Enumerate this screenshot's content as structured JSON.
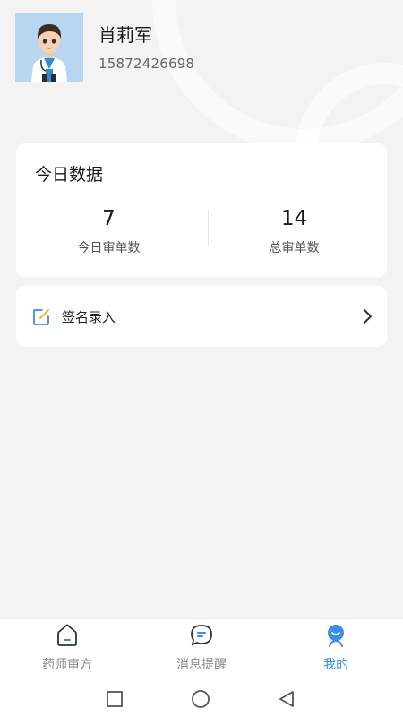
{
  "profile": {
    "name": "肖莉军",
    "phone": "15872426698"
  },
  "today": {
    "title": "今日数据",
    "stats": [
      {
        "value": "7",
        "label": "今日审单数"
      },
      {
        "value": "14",
        "label": "总审单数"
      }
    ]
  },
  "menu": {
    "sign_label": "签名录入"
  },
  "tabs": [
    {
      "label": "药师审方",
      "icon": "home-icon"
    },
    {
      "label": "消息提醒",
      "icon": "message-icon"
    },
    {
      "label": "我的",
      "icon": "profile-icon"
    }
  ],
  "colors": {
    "accent": "#3a8ee6",
    "background": "#f2f3f5"
  }
}
